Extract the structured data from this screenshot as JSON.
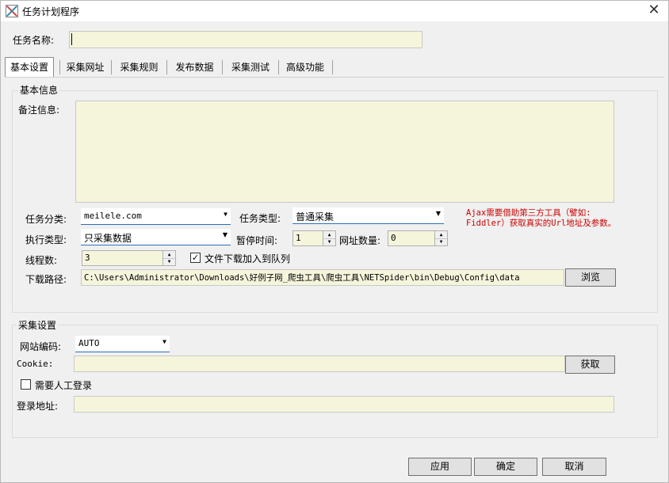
{
  "window": {
    "title": "任务计划程序",
    "close_glyph": "✕"
  },
  "task_name": {
    "label": "任务名称:",
    "value": ""
  },
  "tabs": [
    {
      "label": "基本设置"
    },
    {
      "label": "采集网址"
    },
    {
      "label": "采集规则"
    },
    {
      "label": "发布数据"
    },
    {
      "label": "采集测试"
    },
    {
      "label": "高级功能"
    }
  ],
  "basic_info": {
    "group_title": "基本信息",
    "remark_label": "备注信息:",
    "remark_value": "",
    "category_label": "任务分类:",
    "category_value": "meilele.com",
    "task_type_label": "任务类型:",
    "task_type_value": "普通采集",
    "exec_type_label": "执行类型:",
    "exec_type_value": "只采集数据",
    "pause_label": "暂停时间:",
    "pause_value": "1",
    "url_count_label": "网址数量:",
    "url_count_value": "0",
    "threads_label": "线程数:",
    "threads_value": "3",
    "queue_label": "文件下载加入到队列",
    "queue_checked": true,
    "download_label": "下载路径:",
    "download_value": "C:\\Users\\Administrator\\Downloads\\好例子网_爬虫工具\\爬虫工具\\NETSpider\\bin\\Debug\\Config\\data",
    "browse_label": "浏览",
    "ajax_note_line1": "Ajax需要借助第三方工具（譬如:",
    "ajax_note_line2": "Fiddler）获取真实的Url地址及参数。"
  },
  "collect": {
    "group_title": "采集设置",
    "encoding_label": "网站编码:",
    "encoding_value": "AUTO",
    "cookie_label": "Cookie:",
    "cookie_value": "",
    "fetch_label": "获取",
    "manual_login_label": "需要人工登录",
    "manual_login_checked": false,
    "login_url_label": "登录地址:",
    "login_url_value": ""
  },
  "footer": {
    "apply": "应用",
    "ok": "确定",
    "cancel": "取消"
  },
  "colors": {
    "field_bg": "#f5f5dc",
    "note_red": "#cc0000",
    "combo_underline": "#2b6fb6"
  },
  "icons": {
    "arrow_glyph": "▼",
    "spin_up_glyph": "▲",
    "spin_down_glyph": "▼",
    "check_glyph": "✓"
  }
}
